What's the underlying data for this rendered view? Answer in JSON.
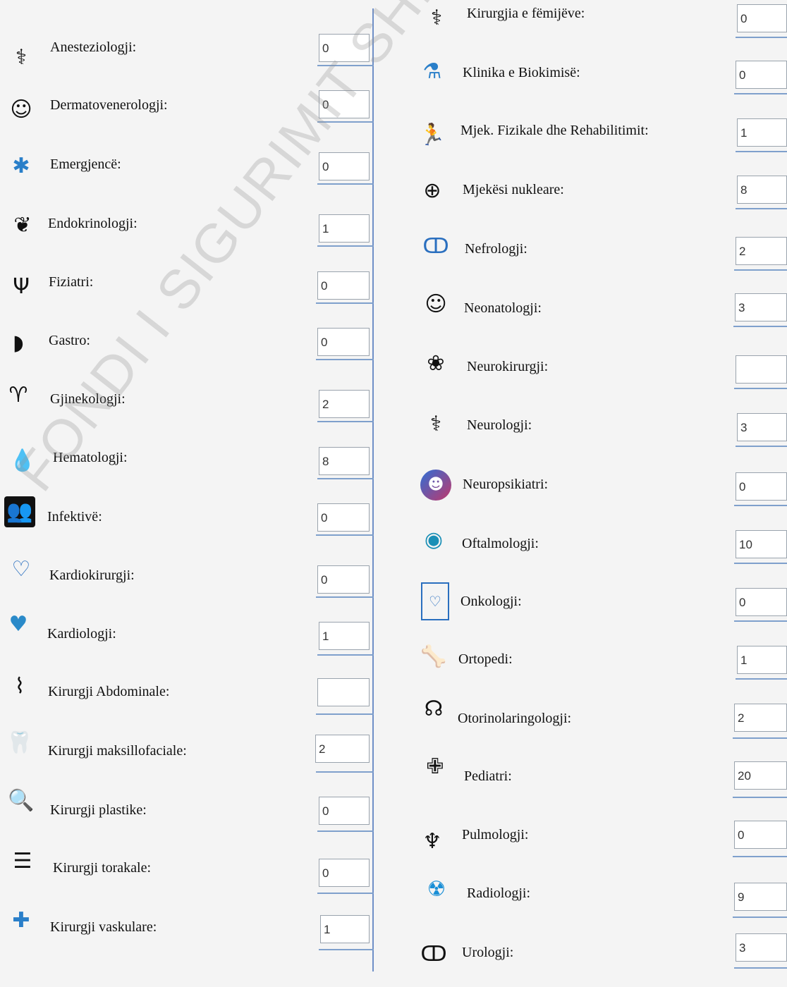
{
  "watermark": "FONDI I SIGURIMIT SHËNDETËSOR",
  "left_column": [
    {
      "label": "Anesteziologji:",
      "value": "0",
      "icon": "anesthesia-mask-icon"
    },
    {
      "label": "Dermatovenerologji:",
      "value": "0",
      "icon": "skin-face-icon"
    },
    {
      "label": "Emergjencë:",
      "value": "0",
      "icon": "star-of-life-icon"
    },
    {
      "label": "Endokrinologji:",
      "value": "1",
      "icon": "thyroid-gland-icon"
    },
    {
      "label": "Fiziatri:",
      "value": "0",
      "icon": "psychology-psi-icon"
    },
    {
      "label": "Gastro:",
      "value": "0",
      "icon": "stomach-icon"
    },
    {
      "label": "Gjinekologji:",
      "value": "2",
      "icon": "uterus-icon"
    },
    {
      "label": "Hematologji:",
      "value": "8",
      "icon": "blood-test-tube-icon"
    },
    {
      "label": "Infektivë:",
      "value": "0",
      "icon": "people-infection-icon"
    },
    {
      "label": "Kardiokirurgji:",
      "value": "0",
      "icon": "heart-surgery-icon"
    },
    {
      "label": "Kardiologji:",
      "value": "1",
      "icon": "heart-hands-icon"
    },
    {
      "label": "Kirurgji Abdominale:",
      "value": "",
      "icon": "abdominal-surgery-icon"
    },
    {
      "label": "Kirurgji maksillofaciale:",
      "value": "2",
      "icon": "tooth-jaw-icon"
    },
    {
      "label": "Kirurgji plastike:",
      "value": "0",
      "icon": "face-magnifier-icon"
    },
    {
      "label": "Kirurgji torakale:",
      "value": "0",
      "icon": "rib-cage-icon"
    },
    {
      "label": "Kirurgji vaskulare:",
      "value": "1",
      "icon": "vascular-surgery-icon"
    }
  ],
  "right_column": [
    {
      "label": "Kirurgjia e fëmijëve:",
      "value": "0",
      "icon": "child-surgery-icon"
    },
    {
      "label": "Klinika e Biokimisë:",
      "value": "0",
      "icon": "lab-flask-dna-icon"
    },
    {
      "label": "Mjek. Fizikale dhe Rehabilitimit:",
      "value": "1",
      "icon": "running-person-icon"
    },
    {
      "label": "Mjekësi nukleare:",
      "value": "8",
      "icon": "nuclear-medicine-icon"
    },
    {
      "label": "Nefrologji:",
      "value": "2",
      "icon": "kidneys-icon"
    },
    {
      "label": "Neonatologji:",
      "value": "3",
      "icon": "newborn-baby-icon"
    },
    {
      "label": "Neurokirurgji:",
      "value": "",
      "icon": "brain-icon"
    },
    {
      "label": "Neurologji:",
      "value": "3",
      "icon": "head-stethoscope-icon"
    },
    {
      "label": "Neuropsikiatri:",
      "value": "0",
      "icon": "mind-head-icon"
    },
    {
      "label": "Oftalmologji:",
      "value": "10",
      "icon": "eye-icon"
    },
    {
      "label": "Onkologji:",
      "value": "0",
      "icon": "oncology-badge-icon"
    },
    {
      "label": "Ortopedi:",
      "value": "1",
      "icon": "bone-tree-icon"
    },
    {
      "label": "Otorinolaringologji:",
      "value": "2",
      "icon": "ear-nose-throat-icon"
    },
    {
      "label": "Pediatri:",
      "value": "20",
      "icon": "baby-cross-icon"
    },
    {
      "label": "Pulmologji:",
      "value": "0",
      "icon": "lungs-icon"
    },
    {
      "label": "Radiologji:",
      "value": "9",
      "icon": "radiation-icon"
    },
    {
      "label": "Urologji:",
      "value": "3",
      "icon": "urinary-tract-icon"
    }
  ],
  "colors": {
    "divider": "#6f8fc7",
    "underline": "#7fa0cc",
    "field_border": "#9aa3ad"
  }
}
